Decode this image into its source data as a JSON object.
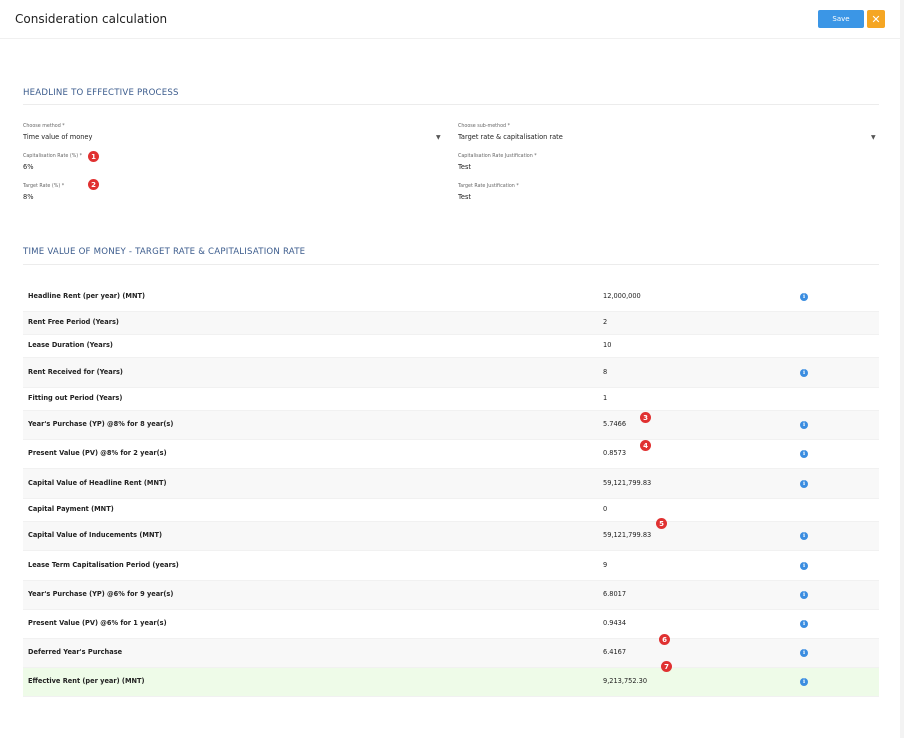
{
  "header": {
    "title": "Consideration calculation",
    "save_label": "Save",
    "close_label": "✕"
  },
  "headline_section": {
    "title": "HEADLINE TO EFFECTIVE PROCESS"
  },
  "form": {
    "method_label": "Choose method *",
    "method_value": "Time value of money",
    "submethod_label": "Choose sub-method *",
    "submethod_value": "Target rate & capitalisation rate",
    "cap_rate_label": "Capitalisation Rate (%) *",
    "cap_rate_value": "6%",
    "cap_rate_just_label": "Capitalisation Rate Justification *",
    "cap_rate_just_value": "Test",
    "target_rate_label": "Target Rate (%) *",
    "target_rate_value": "8%",
    "target_rate_just_label": "Target Rate Justification *",
    "target_rate_just_value": "Test"
  },
  "tvm_section": {
    "title": "TIME VALUE OF MONEY - TARGET RATE & CAPITALISATION RATE"
  },
  "badges": [
    "1",
    "2",
    "3",
    "4",
    "5",
    "6",
    "7"
  ],
  "rows": [
    {
      "label": "Headline Rent (per year) (MNT)",
      "value": "12,000,000",
      "info": true
    },
    {
      "label": "Rent Free Period (Years)",
      "value": "2",
      "info": false
    },
    {
      "label": "Lease Duration (Years)",
      "value": "10",
      "info": false
    },
    {
      "label": "Rent Received for (Years)",
      "value": "8",
      "info": true
    },
    {
      "label": "Fitting out Period (Years)",
      "value": "1",
      "info": false
    },
    {
      "label": "Year's Purchase (YP) @8% for 8 year(s)",
      "value": "5.7466",
      "info": true
    },
    {
      "label": "Present Value (PV) @8% for 2 year(s)",
      "value": "0.8573",
      "info": true
    },
    {
      "label": "Capital Value of Headline Rent (MNT)",
      "value": "59,121,799.83",
      "info": true
    },
    {
      "label": "Capital Payment (MNT)",
      "value": "0",
      "info": false
    },
    {
      "label": "Capital Value of Inducements (MNT)",
      "value": "59,121,799.83",
      "info": true
    },
    {
      "label": "Lease Term Capitalisation Period (years)",
      "value": "9",
      "info": true
    },
    {
      "label": "Year's Purchase (YP) @6% for 9 year(s)",
      "value": "6.8017",
      "info": true
    },
    {
      "label": "Present Value (PV) @6% for 1 year(s)",
      "value": "0.9434",
      "info": true
    },
    {
      "label": "Deferred Year's Purchase",
      "value": "6.4167",
      "info": true
    },
    {
      "label": "Effective Rent (per year) (MNT)",
      "value": "9,213,752.30",
      "info": true
    }
  ],
  "info_glyph": "i"
}
